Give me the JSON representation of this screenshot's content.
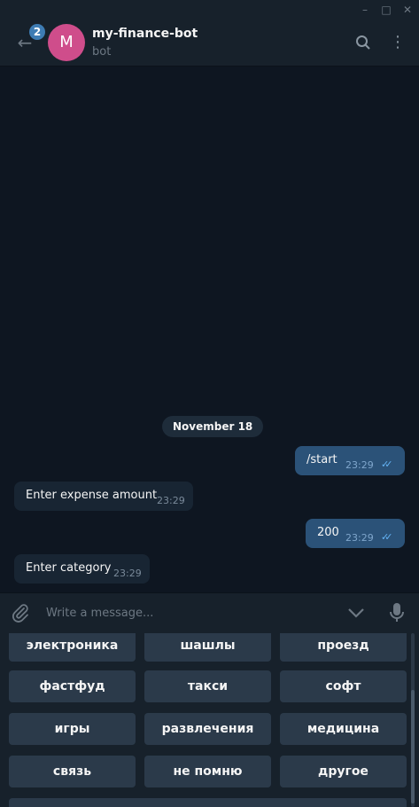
{
  "window": {
    "minimize_icon": "minimize-icon",
    "maximize_icon": "maximize-icon",
    "close_icon": "close-icon"
  },
  "header": {
    "unread_count": "2",
    "avatar_letter": "M",
    "title": "my-finance-bot",
    "subtitle": "bot",
    "icons": [
      "back-arrow-icon",
      "search-icon",
      "more-vertical-icon"
    ]
  },
  "chat": {
    "date": "November 18",
    "messages": [
      {
        "direction": "out",
        "text": "/start",
        "time": "23:29",
        "read": true
      },
      {
        "direction": "in",
        "text": "Enter expense amount",
        "time": "23:29"
      },
      {
        "direction": "out",
        "text": "200",
        "time": "23:29",
        "read": true
      },
      {
        "direction": "in",
        "text": "Enter category",
        "time": "23:29"
      }
    ]
  },
  "composer": {
    "placeholder": "Write a message...",
    "icons": [
      "paperclip-icon",
      "chevron-down-icon",
      "microphone-icon"
    ]
  },
  "keyboard": {
    "rows": [
      [
        "электроника",
        "шашлы",
        "проезд"
      ],
      [
        "фастфуд",
        "такси",
        "софт"
      ],
      [
        "игры",
        "развлечения",
        "медицина"
      ],
      [
        "связь",
        "не помню",
        "другое"
      ]
    ]
  },
  "colors": {
    "background": "#0e1621",
    "header": "#17212b",
    "outgoing_bubble": "#2b5278",
    "incoming_bubble": "#182533",
    "avatar": "#cf4d8b",
    "badge": "#3e7cb3",
    "read_check": "#64b3f5"
  }
}
